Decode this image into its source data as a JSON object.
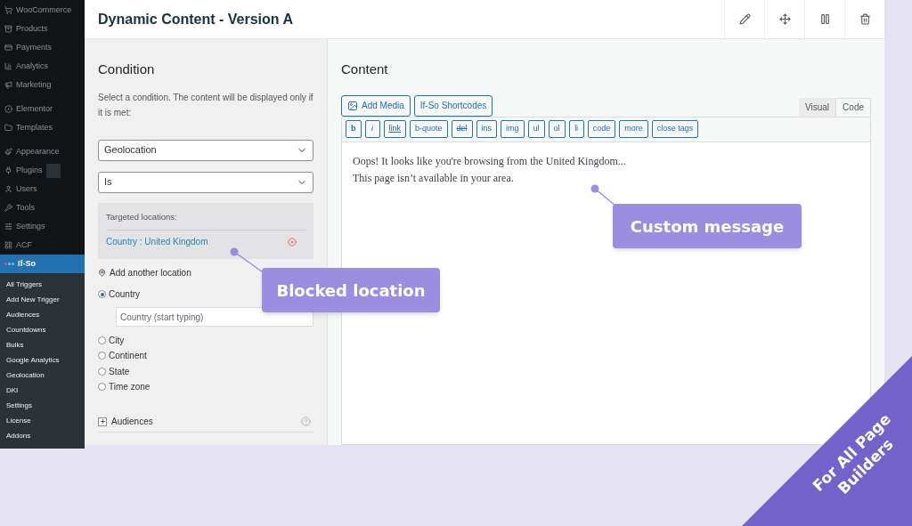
{
  "sidebar": {
    "groups": [
      {
        "items": [
          {
            "label": "WooCommerce",
            "selected": false
          },
          {
            "label": "Products",
            "selected": false
          },
          {
            "label": "Payments",
            "selected": false
          },
          {
            "label": "Analytics",
            "selected": false
          },
          {
            "label": "Marketing",
            "selected": false
          }
        ]
      },
      {
        "items": [
          {
            "label": "Elementor",
            "selected": false
          },
          {
            "label": "Templates",
            "selected": false
          }
        ]
      },
      {
        "items": [
          {
            "label": "Appearance",
            "selected": false
          },
          {
            "label": "Plugins",
            "selected": false,
            "badge": true
          },
          {
            "label": "Users",
            "selected": false
          },
          {
            "label": "Tools",
            "selected": false
          },
          {
            "label": "Settings",
            "selected": false
          },
          {
            "label": "ACF",
            "selected": false
          },
          {
            "label": "If-So",
            "selected": true
          }
        ]
      }
    ],
    "submenu": [
      "All Triggers",
      "Add New Trigger",
      "Audiences",
      "Countdowns",
      "Bulks",
      "Google Analytics",
      "Geolocation",
      "DKI",
      "Settings",
      "License",
      "Addons"
    ]
  },
  "header": {
    "title": "Dynamic Content - Version A"
  },
  "condition": {
    "title": "Condition",
    "description": "Select a condition. The content will be displayed only if it is met:",
    "selects": [
      "Geolocation",
      "Is"
    ],
    "targeted": {
      "title": "Targeted locations:",
      "locations": [
        "Country : United Kingdom"
      ]
    },
    "add_location": "Add another location",
    "options": [
      {
        "label": "Country",
        "selected": true
      },
      {
        "label": "City",
        "selected": false
      },
      {
        "label": "Continent",
        "selected": false
      },
      {
        "label": "State",
        "selected": false
      },
      {
        "label": "Time zone",
        "selected": false
      }
    ],
    "country_field": {
      "placeholder": "Country (start typing)"
    },
    "audiences": "Audiences"
  },
  "content": {
    "title": "Content",
    "buttons": [
      "Add Media",
      "If-So Shortcodes"
    ],
    "tabs": [
      {
        "label": "Visual",
        "selected": false
      },
      {
        "label": "Code",
        "selected": true
      }
    ],
    "quicktags": [
      {
        "label": "b",
        "kind": "bold"
      },
      {
        "label": "i",
        "kind": "italic"
      },
      {
        "label": "link",
        "kind": "underline"
      },
      {
        "label": "b-quote",
        "kind": "plain"
      },
      {
        "label": "del",
        "kind": "strike"
      },
      {
        "label": "ins",
        "kind": "plain"
      },
      {
        "label": "img",
        "kind": "plain"
      },
      {
        "label": "ul",
        "kind": "plain"
      },
      {
        "label": "ol",
        "kind": "plain"
      },
      {
        "label": "li",
        "kind": "plain"
      },
      {
        "label": "code",
        "kind": "plain"
      },
      {
        "label": "more",
        "kind": "plain"
      },
      {
        "label": "close tags",
        "kind": "plain"
      }
    ],
    "text": [
      "Oops! It looks like you're browsing from the United Kingdom...",
      "This page isn’t available in your area."
    ]
  },
  "callouts": [
    "Blocked location",
    "Custom message"
  ],
  "banner": [
    "For All Page",
    "Builders"
  ]
}
